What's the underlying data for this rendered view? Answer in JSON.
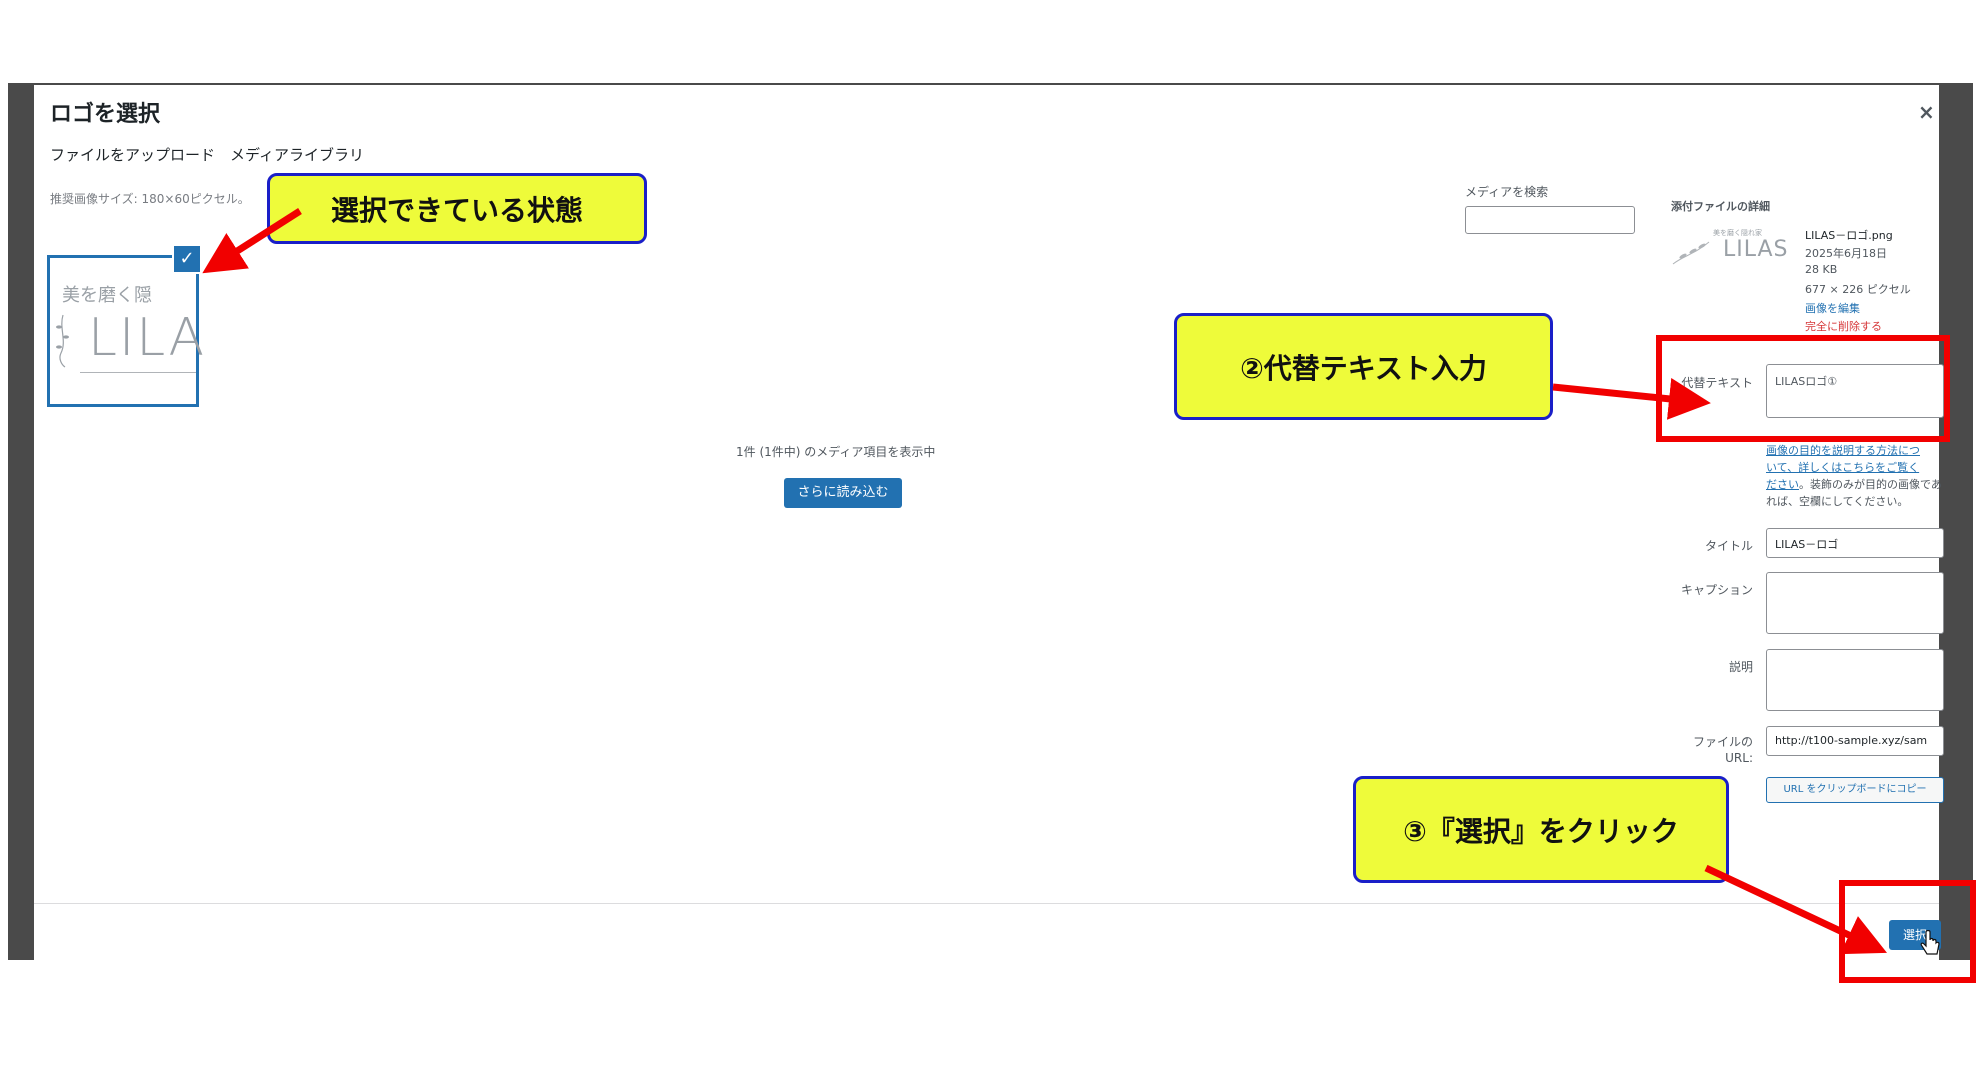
{
  "modal": {
    "title": "ロゴを選択",
    "close_icon": "×",
    "tabs": [
      {
        "label": "ファイルをアップロード"
      },
      {
        "label": "メディアライブラリ"
      }
    ],
    "recommended_size": "推奨画像サイズ: 180×60ピクセル。"
  },
  "library": {
    "thumbnail": {
      "logo_top_text": "美を磨く隠",
      "logo_text": "LILA",
      "check_icon": "✓"
    },
    "count_text": "1件 (1件中) のメディア項目を表示中",
    "load_more_label": "さらに読み込む"
  },
  "search": {
    "label": "メディアを検索",
    "value": ""
  },
  "details": {
    "heading": "添付ファイルの詳細",
    "thumb_small_text": "美を磨く隠れ家",
    "thumb_big_text": "LILAS",
    "file_name": "LILAS－ロゴ.png",
    "upload_date": "2025年6月18日",
    "file_size": "28 KB",
    "dimensions": "677 × 226 ピクセル",
    "edit_link": "画像を編集",
    "delete_link": "完全に削除する",
    "alt_label": "代替テキスト",
    "alt_value": "LILASロゴ①",
    "alt_help_line1": "画像の目的を説明する方法につ",
    "alt_help_link": "いて、詳しくはこちらをご覧く",
    "alt_help_link2": "ださい",
    "alt_help_rest": "。装飾のみが目的の画像であれば、空欄にしてください。",
    "title_label": "タイトル",
    "title_value": "LILAS－ロゴ",
    "caption_label": "キャプション",
    "caption_value": "",
    "description_label": "説明",
    "description_value": "",
    "url_label_1": "ファイルの",
    "url_label_2": "URL:",
    "url_value": "http://t100-sample.xyz/sam",
    "copy_url_label": "URL をクリップボードにコピー"
  },
  "footer": {
    "select_label": "選択"
  },
  "annotations": {
    "selected_state": "選択できている状態",
    "alt_input": "②代替テキスト入力",
    "click_select": "③『選択』をクリック",
    "callout_fill": "#eefb3a",
    "callout_border": "#1a1fc8",
    "highlight_color": "#f10000"
  },
  "colors": {
    "accent": "#2271b1",
    "danger": "#d63638"
  }
}
